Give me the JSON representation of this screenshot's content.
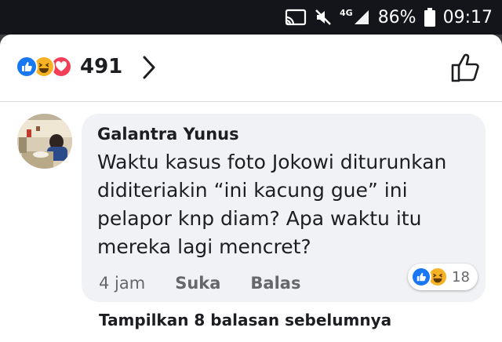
{
  "status_bar": {
    "network": "4G",
    "battery": "86%",
    "time": "09:17",
    "icons": [
      "cast-icon",
      "mute-icon",
      "signal-icon",
      "battery-icon"
    ]
  },
  "reactions_header": {
    "icons": [
      "like-icon",
      "haha-icon",
      "love-icon"
    ],
    "count": "491"
  },
  "comment": {
    "author": "Galantra Yunus",
    "text": "Waktu kasus foto Jokowi diturunkan\ndiditeriakin “ini kacung gue” ini\npelapor knp diam? Apa waktu itu\nmereka lagi mencret?",
    "time": "4 jam",
    "like_label": "Suka",
    "reply_label": "Balas",
    "reaction_icons": [
      "like-icon",
      "haha-icon"
    ],
    "reaction_count": "18"
  },
  "more_replies_label": "Tampilkan 8 balasan sebelumnya",
  "colors": {
    "like": "#1877f2",
    "haha": "#f7b125",
    "love": "#f33e58",
    "bubble": "#f0f2f5",
    "meta_text": "#65676b"
  }
}
